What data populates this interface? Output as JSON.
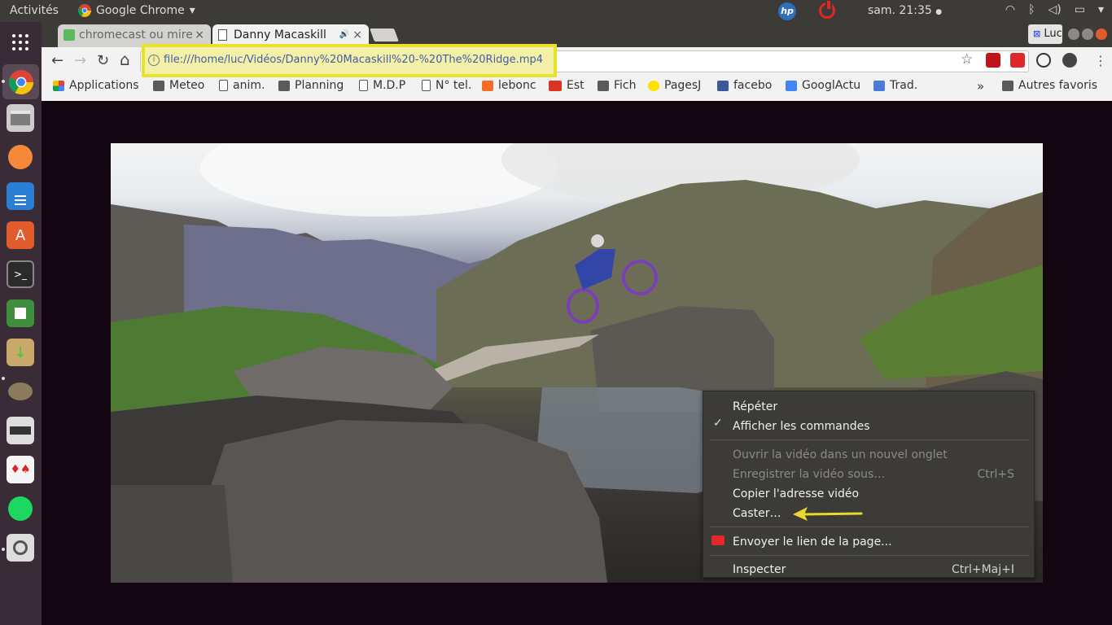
{
  "topbar": {
    "activities": "Activités",
    "app_name": "Google Chrome",
    "app_menu_arrow": "▾",
    "hp_label": "hp",
    "clock": "sam. 21:35",
    "clock_dot": "●",
    "tray_icons": [
      "wifi-icon",
      "bluetooth-icon",
      "volume-icon",
      "battery-icon",
      "system-menu-icon"
    ]
  },
  "tabs": [
    {
      "title": "chromecast ou mire",
      "close": "×"
    },
    {
      "title": "Danny Macaskill",
      "audio": "🔊",
      "close": "×"
    }
  ],
  "profile": {
    "name": "Luc"
  },
  "toolbar": {
    "back": "←",
    "forward": "→",
    "reload": "↻",
    "home": "⌂",
    "url": "file:///home/luc/Vidéos/Danny%20Macaskill%20-%20The%20Ridge.mp4",
    "star": "☆",
    "menu": "⋮"
  },
  "bookmarks": [
    {
      "label": "Applications",
      "icon": "apps-grid-icon"
    },
    {
      "label": "Meteo",
      "icon": "folder-icon"
    },
    {
      "label": "anim.",
      "icon": "page-icon"
    },
    {
      "label": "Planning",
      "icon": "folder-icon"
    },
    {
      "label": "M.D.P",
      "icon": "page-icon"
    },
    {
      "label": "N° tel.",
      "icon": "page-icon"
    },
    {
      "label": "lebonc",
      "icon": "leboncoin-icon"
    },
    {
      "label": "Est",
      "icon": "est-icon"
    },
    {
      "label": "Fich",
      "icon": "folder-icon"
    },
    {
      "label": "PagesJ",
      "icon": "pagesjaunes-icon"
    },
    {
      "label": "facebo",
      "icon": "facebook-icon"
    },
    {
      "label": "GooglActu",
      "icon": "google-news-icon"
    },
    {
      "label": "Trad.",
      "icon": "google-translate-icon"
    }
  ],
  "bookmarks_overflow": "»",
  "other_bookmarks": "Autres favoris",
  "context_menu": {
    "items": [
      {
        "label": "Répéter",
        "enabled": true
      },
      {
        "label": "Afficher les commandes",
        "enabled": true,
        "checked": true,
        "check": "✓"
      },
      {
        "label": "Ouvrir la vidéo dans un nouvel onglet",
        "enabled": false
      },
      {
        "label": "Enregistrer la vidéo sous…",
        "enabled": false,
        "shortcut": "Ctrl+S"
      },
      {
        "label": "Copier l'adresse vidéo",
        "enabled": true
      },
      {
        "label": "Caster…",
        "enabled": true
      },
      {
        "label": "Envoyer le lien de la page...",
        "enabled": true
      },
      {
        "label": "Inspecter",
        "enabled": true,
        "shortcut": "Ctrl+Maj+I"
      }
    ]
  },
  "colors": {
    "highlight": "#e8e22c",
    "arrow": "#e8d92a",
    "menu_bg": "#3c3b37"
  }
}
